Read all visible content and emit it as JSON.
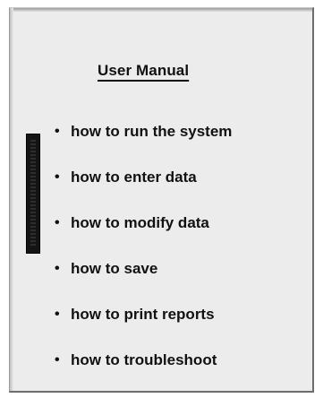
{
  "manual": {
    "title": "User Manual",
    "items": [
      {
        "label": "how to run the system"
      },
      {
        "label": "how to enter data"
      },
      {
        "label": "how to modify data"
      },
      {
        "label": "how to save"
      },
      {
        "label": "how to print reports"
      },
      {
        "label": "how to troubleshoot"
      }
    ],
    "bullet": "•"
  },
  "colors": {
    "background": "#ececec",
    "text": "#111111",
    "scrollbar": "#141414"
  }
}
